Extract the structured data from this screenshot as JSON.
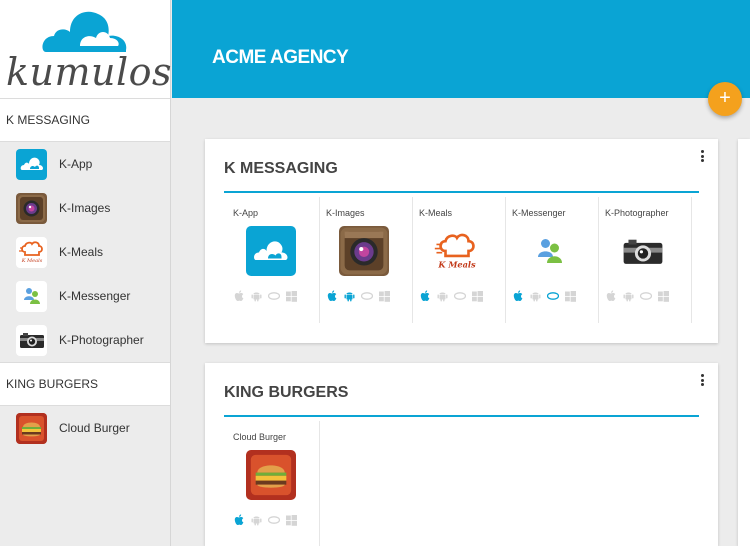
{
  "logo": {
    "text": "kumulos"
  },
  "colors": {
    "accent": "#0aa4d4",
    "fab": "#f4a11d",
    "platform_active": "#0aa4d4",
    "platform_inactive": "#d5d5d5"
  },
  "sidebar": {
    "groups": [
      {
        "title": "K MESSAGING",
        "items": [
          "K-App",
          "K-Images",
          "K-Meals",
          "K-Messenger",
          "K-Photographer"
        ]
      },
      {
        "title": "KING BURGERS",
        "items": [
          "Cloud Burger"
        ]
      }
    ]
  },
  "header": {
    "title": "ACME AGENCY",
    "add_label": "+"
  },
  "cards": [
    {
      "title": "K MESSAGING",
      "apps": [
        {
          "name": "K-App",
          "icon": "cloud-app-icon",
          "platforms": {
            "ios": false,
            "android": false,
            "windows": false,
            "web": false
          }
        },
        {
          "name": "K-Images",
          "icon": "camera-app-icon",
          "platforms": {
            "ios": true,
            "android": true,
            "windows": false,
            "web": false
          }
        },
        {
          "name": "K-Meals",
          "icon": "chef-hat-app-icon",
          "platforms": {
            "ios": true,
            "android": false,
            "windows": false,
            "web": false
          }
        },
        {
          "name": "K-Messenger",
          "icon": "messenger-people-app-icon",
          "platforms": {
            "ios": true,
            "android": false,
            "windows": true,
            "web": false
          }
        },
        {
          "name": "K-Photographer",
          "icon": "retro-camera-app-icon",
          "platforms": {
            "ios": false,
            "android": false,
            "windows": false,
            "web": false
          }
        }
      ]
    },
    {
      "title": "KING BURGERS",
      "apps": [
        {
          "name": "Cloud Burger",
          "icon": "burger-app-icon",
          "platforms": {
            "ios": true,
            "android": false,
            "windows": false,
            "web": false
          }
        }
      ]
    }
  ],
  "meals_icon_caption": "K Meals"
}
